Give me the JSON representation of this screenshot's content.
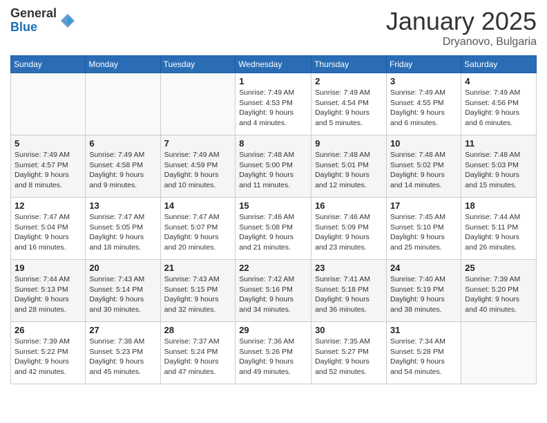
{
  "header": {
    "logo_general": "General",
    "logo_blue": "Blue",
    "month_title": "January 2025",
    "location": "Dryanovo, Bulgaria"
  },
  "weekdays": [
    "Sunday",
    "Monday",
    "Tuesday",
    "Wednesday",
    "Thursday",
    "Friday",
    "Saturday"
  ],
  "weeks": [
    [
      {
        "day": "",
        "info": ""
      },
      {
        "day": "",
        "info": ""
      },
      {
        "day": "",
        "info": ""
      },
      {
        "day": "1",
        "info": "Sunrise: 7:49 AM\nSunset: 4:53 PM\nDaylight: 9 hours\nand 4 minutes."
      },
      {
        "day": "2",
        "info": "Sunrise: 7:49 AM\nSunset: 4:54 PM\nDaylight: 9 hours\nand 5 minutes."
      },
      {
        "day": "3",
        "info": "Sunrise: 7:49 AM\nSunset: 4:55 PM\nDaylight: 9 hours\nand 6 minutes."
      },
      {
        "day": "4",
        "info": "Sunrise: 7:49 AM\nSunset: 4:56 PM\nDaylight: 9 hours\nand 6 minutes."
      }
    ],
    [
      {
        "day": "5",
        "info": "Sunrise: 7:49 AM\nSunset: 4:57 PM\nDaylight: 9 hours\nand 8 minutes."
      },
      {
        "day": "6",
        "info": "Sunrise: 7:49 AM\nSunset: 4:58 PM\nDaylight: 9 hours\nand 9 minutes."
      },
      {
        "day": "7",
        "info": "Sunrise: 7:49 AM\nSunset: 4:59 PM\nDaylight: 9 hours\nand 10 minutes."
      },
      {
        "day": "8",
        "info": "Sunrise: 7:48 AM\nSunset: 5:00 PM\nDaylight: 9 hours\nand 11 minutes."
      },
      {
        "day": "9",
        "info": "Sunrise: 7:48 AM\nSunset: 5:01 PM\nDaylight: 9 hours\nand 12 minutes."
      },
      {
        "day": "10",
        "info": "Sunrise: 7:48 AM\nSunset: 5:02 PM\nDaylight: 9 hours\nand 14 minutes."
      },
      {
        "day": "11",
        "info": "Sunrise: 7:48 AM\nSunset: 5:03 PM\nDaylight: 9 hours\nand 15 minutes."
      }
    ],
    [
      {
        "day": "12",
        "info": "Sunrise: 7:47 AM\nSunset: 5:04 PM\nDaylight: 9 hours\nand 16 minutes."
      },
      {
        "day": "13",
        "info": "Sunrise: 7:47 AM\nSunset: 5:05 PM\nDaylight: 9 hours\nand 18 minutes."
      },
      {
        "day": "14",
        "info": "Sunrise: 7:47 AM\nSunset: 5:07 PM\nDaylight: 9 hours\nand 20 minutes."
      },
      {
        "day": "15",
        "info": "Sunrise: 7:46 AM\nSunset: 5:08 PM\nDaylight: 9 hours\nand 21 minutes."
      },
      {
        "day": "16",
        "info": "Sunrise: 7:46 AM\nSunset: 5:09 PM\nDaylight: 9 hours\nand 23 minutes."
      },
      {
        "day": "17",
        "info": "Sunrise: 7:45 AM\nSunset: 5:10 PM\nDaylight: 9 hours\nand 25 minutes."
      },
      {
        "day": "18",
        "info": "Sunrise: 7:44 AM\nSunset: 5:11 PM\nDaylight: 9 hours\nand 26 minutes."
      }
    ],
    [
      {
        "day": "19",
        "info": "Sunrise: 7:44 AM\nSunset: 5:13 PM\nDaylight: 9 hours\nand 28 minutes."
      },
      {
        "day": "20",
        "info": "Sunrise: 7:43 AM\nSunset: 5:14 PM\nDaylight: 9 hours\nand 30 minutes."
      },
      {
        "day": "21",
        "info": "Sunrise: 7:43 AM\nSunset: 5:15 PM\nDaylight: 9 hours\nand 32 minutes."
      },
      {
        "day": "22",
        "info": "Sunrise: 7:42 AM\nSunset: 5:16 PM\nDaylight: 9 hours\nand 34 minutes."
      },
      {
        "day": "23",
        "info": "Sunrise: 7:41 AM\nSunset: 5:18 PM\nDaylight: 9 hours\nand 36 minutes."
      },
      {
        "day": "24",
        "info": "Sunrise: 7:40 AM\nSunset: 5:19 PM\nDaylight: 9 hours\nand 38 minutes."
      },
      {
        "day": "25",
        "info": "Sunrise: 7:39 AM\nSunset: 5:20 PM\nDaylight: 9 hours\nand 40 minutes."
      }
    ],
    [
      {
        "day": "26",
        "info": "Sunrise: 7:39 AM\nSunset: 5:22 PM\nDaylight: 9 hours\nand 42 minutes."
      },
      {
        "day": "27",
        "info": "Sunrise: 7:38 AM\nSunset: 5:23 PM\nDaylight: 9 hours\nand 45 minutes."
      },
      {
        "day": "28",
        "info": "Sunrise: 7:37 AM\nSunset: 5:24 PM\nDaylight: 9 hours\nand 47 minutes."
      },
      {
        "day": "29",
        "info": "Sunrise: 7:36 AM\nSunset: 5:26 PM\nDaylight: 9 hours\nand 49 minutes."
      },
      {
        "day": "30",
        "info": "Sunrise: 7:35 AM\nSunset: 5:27 PM\nDaylight: 9 hours\nand 52 minutes."
      },
      {
        "day": "31",
        "info": "Sunrise: 7:34 AM\nSunset: 5:28 PM\nDaylight: 9 hours\nand 54 minutes."
      },
      {
        "day": "",
        "info": ""
      }
    ]
  ]
}
